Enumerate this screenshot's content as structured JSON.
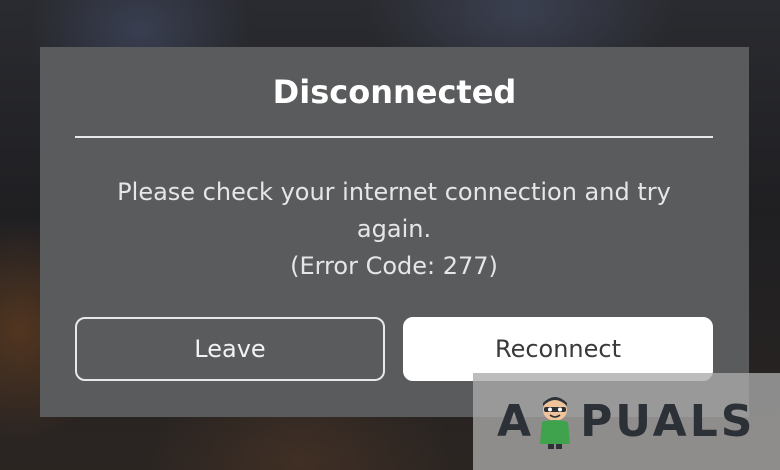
{
  "dialog": {
    "title": "Disconnected",
    "message_line1": "Please check your internet connection and try",
    "message_line2": "again.",
    "message_line3": "(Error Code: 277)",
    "leave_label": "Leave",
    "reconnect_label": "Reconnect"
  },
  "watermark": {
    "text_left": "A",
    "text_right": "PUALS",
    "mascot_icon": "appuals-mascot-icon"
  },
  "colors": {
    "dialog_bg": "#5a5b5d",
    "title_text": "#ffffff",
    "reconnect_bg": "#ffffff",
    "reconnect_text": "#3a3a3a",
    "leave_border": "#e8e8e8"
  }
}
